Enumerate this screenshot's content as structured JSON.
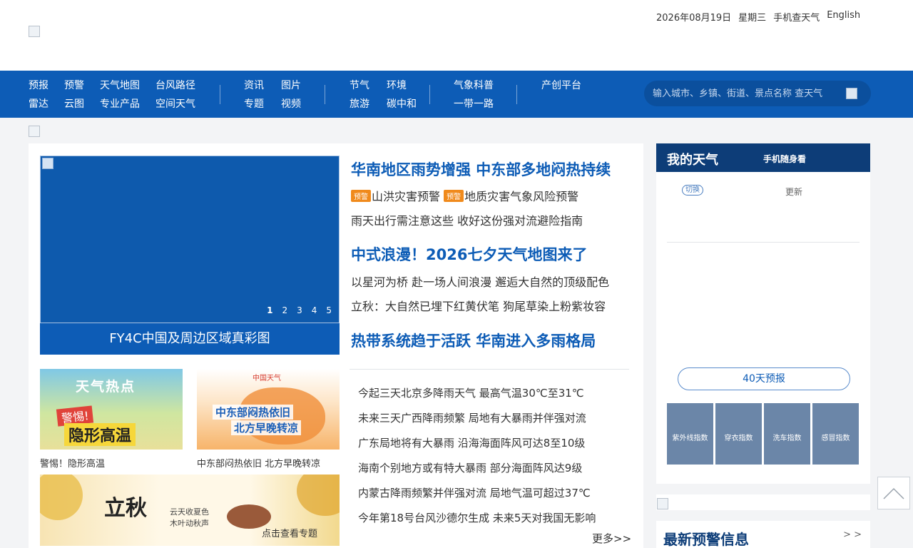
{
  "header": {
    "date": "2026年08月19日",
    "weekday": "星期三",
    "mobile_link": "手机查天气",
    "english_link": "English"
  },
  "nav": {
    "groups": [
      [
        "预报",
        "预警",
        "天气地图",
        "台风路径"
      ],
      [
        "雷达",
        "云图",
        "专业产品",
        "空间天气"
      ],
      [
        "资讯",
        "图片"
      ],
      [
        "专题",
        "视频"
      ],
      [
        "节气",
        "环境"
      ],
      [
        "旅游",
        "碳中和"
      ],
      [
        "气象科普"
      ],
      [
        "一带一路"
      ],
      [
        "产创平台"
      ]
    ]
  },
  "search": {
    "placeholder": "输入城市、乡镇、街道、景点名称 查天气"
  },
  "carousel": {
    "pages": [
      "1",
      "2",
      "3",
      "4",
      "5"
    ],
    "caption": "FY4C中国及周边区域真彩图"
  },
  "headlines": [
    {
      "title": "华南地区雨势增强 中东部多地闷热持续",
      "warn_tag": "预警",
      "warn1": "山洪灾害预警",
      "warn2": "地质灾害气象风险预警",
      "sub": "雨天出行需注意这些 收好这份强对流避险指南"
    },
    {
      "title": "中式浪漫！2026七夕天气地图来了",
      "sub1": "以星河为桥 赴一场人间浪漫 邂逅大自然的顶级配色",
      "sub2": "立秋：大自然已埋下红黄伏笔 狗尾草染上粉紫妆容"
    },
    {
      "title": "热带系统趋于活跃 华南进入多雨格局"
    }
  ],
  "news": [
    "今起三天北京多降雨天气 最高气温30℃至31℃",
    "未来三天广西降雨频繁 局地有大暴雨并伴强对流",
    "广东局地将有大暴雨 沿海海面阵风可达8至10级",
    "海南个别地方或有特大暴雨 部分海面阵风达9级",
    "内蒙古降雨频繁并伴强对流 局地气温可超过37℃",
    "今年第18号台风沙德尔生成 未来5天对我国无影响"
  ],
  "more": "更多>>",
  "thumbs": [
    {
      "caption": "警惕！隐形高温",
      "line1": "天气热点",
      "line2": "警惕!",
      "line3": "隐形高温"
    },
    {
      "caption": "中东部闷热依旧 北方早晚转凉",
      "brand": "中国天气",
      "line1": "中东部闷热依旧",
      "line2": "北方早晚转凉"
    }
  ],
  "autumn": {
    "title": "立秋",
    "verse1": "云天收夏色",
    "verse2": "木叶动秋声",
    "cta": "点击查看专题"
  },
  "my_weather": {
    "title": "我的天气",
    "mobile": "手机随身看",
    "switch": "切换",
    "update": "更新",
    "forecast40": "40天预报",
    "indices": [
      "紫外线指数",
      "穿衣指数",
      "洗车指数",
      "感冒指数"
    ]
  },
  "warning_panel": {
    "title": "最新预警信息",
    "more": "> >"
  },
  "colors": {
    "nav_blue": "#0d5cb6",
    "dark_blue": "#0d3d78",
    "warn_orange": "#f08a1c"
  }
}
